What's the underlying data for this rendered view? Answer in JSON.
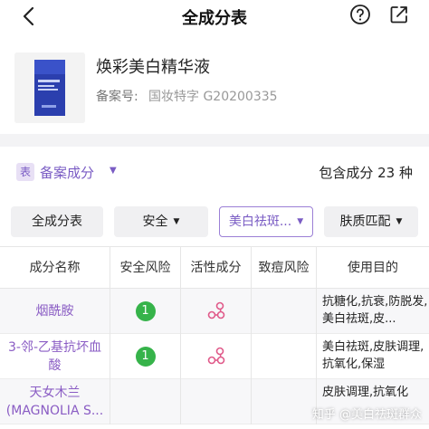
{
  "header": {
    "title": "全成分表"
  },
  "product": {
    "name": "焕彩美白精华液",
    "reg_label": "备案号:",
    "reg_value": "国妆特字 G20200335"
  },
  "summary": {
    "badge": "表",
    "label": "备案成分",
    "count_text": "包含成分 23 种"
  },
  "filters": [
    {
      "label": "全成分表",
      "caret": false,
      "active": false
    },
    {
      "label": "安全",
      "caret": true,
      "active": false
    },
    {
      "label": "美白祛斑...",
      "caret": true,
      "active": true
    },
    {
      "label": "肤质匹配",
      "caret": true,
      "active": false
    }
  ],
  "table": {
    "headers": [
      "成分名称",
      "安全风险",
      "活性成分",
      "致痘风险",
      "使用目的"
    ],
    "rows": [
      {
        "name": "烟酰胺",
        "risk": "1",
        "active": true,
        "purpose": "抗糖化,抗衰,防脱发,美白祛斑,皮..."
      },
      {
        "name": "3-邻-乙基抗坏血酸",
        "risk": "1",
        "active": true,
        "purpose": "美白祛斑,皮肤调理,抗氧化,保湿"
      },
      {
        "name": "天女木兰(MAGNOLIA S...",
        "risk": "",
        "active": false,
        "purpose": "皮肤调理,抗氧化"
      }
    ]
  },
  "watermark": "知乎 @美白祛斑群众",
  "colors": {
    "accent": "#7a5cc4",
    "safe_green": "#36b34a",
    "active_pink": "#e05a8a"
  }
}
